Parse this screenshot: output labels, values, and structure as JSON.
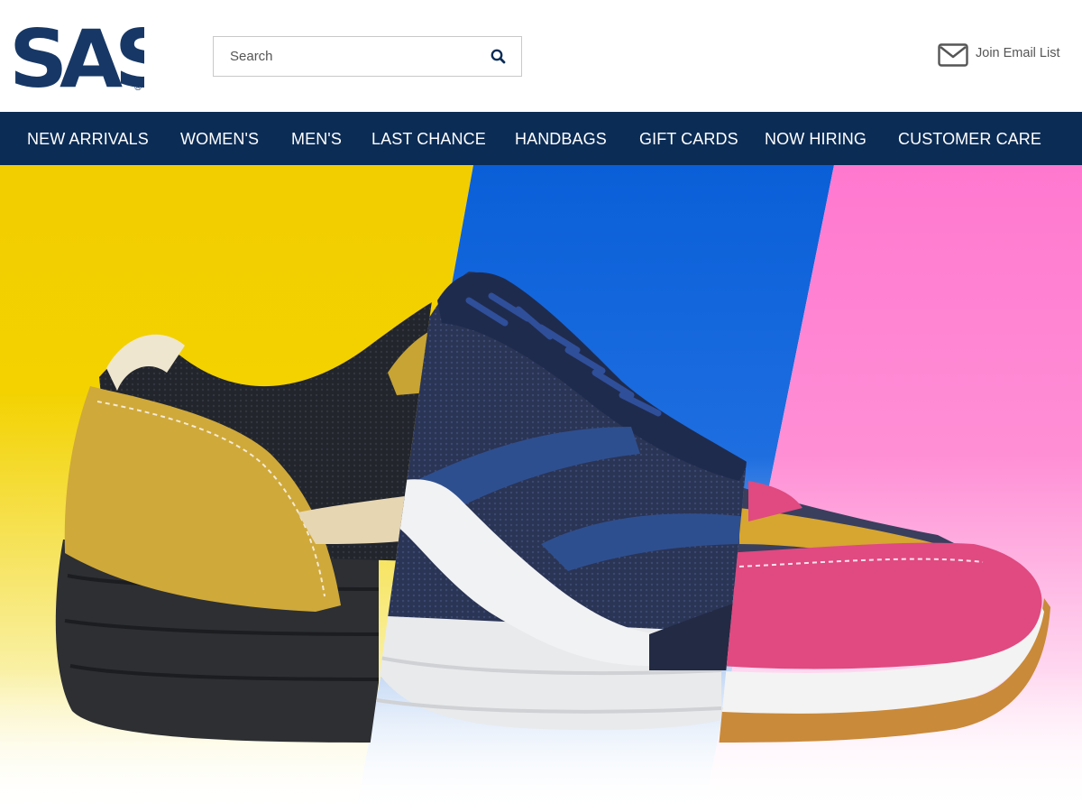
{
  "brand": {
    "logo_text": "SAS",
    "registered_mark": "®"
  },
  "search": {
    "placeholder": "Search"
  },
  "header": {
    "email_label": "Join Email List"
  },
  "nav": {
    "items": [
      {
        "label": "NEW ARRIVALS"
      },
      {
        "label": "WOMEN'S"
      },
      {
        "label": "MEN'S"
      },
      {
        "label": "LAST CHANCE"
      },
      {
        "label": "HANDBAGS"
      },
      {
        "label": "GIFT CARDS"
      },
      {
        "label": "NOW HIRING"
      },
      {
        "label": "CUSTOMER CARE"
      }
    ]
  },
  "hero": {
    "icon": "sneaker-image",
    "panel_colors": {
      "left": "#f2cd00",
      "middle": "#0a5fd8",
      "right": "#ff78cf"
    }
  },
  "colors": {
    "brand_navy": "#0b2c55",
    "logo_navy": "#173866"
  }
}
